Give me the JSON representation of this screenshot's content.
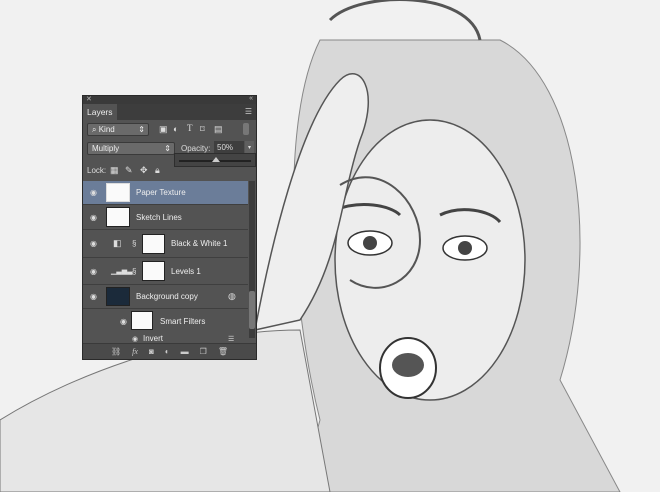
{
  "panel": {
    "title": "Layers",
    "filter_kind": "Kind",
    "blend_mode": "Multiply",
    "opacity_label": "Opacity:",
    "opacity_value": "50%",
    "opacity_slider_percent": 50,
    "lock_label": "Lock:",
    "selection_color": "#6b7d99",
    "layers": [
      {
        "name": "Paper Texture",
        "selected": true
      },
      {
        "name": "Sketch Lines"
      },
      {
        "name": "Black & White 1",
        "adjustment": "black-white-icon"
      },
      {
        "name": "Levels 1",
        "adjustment": "levels-icon"
      },
      {
        "name": "Background copy",
        "smart_object": true
      },
      {
        "name": "Smart Filters"
      },
      {
        "name": "Invert"
      }
    ],
    "footer_icons": [
      "link-icon",
      "fx-icon",
      "mask-icon",
      "adjustment-icon",
      "folder-icon",
      "new-layer-icon",
      "trash-icon"
    ],
    "footer_fx": "fx"
  }
}
